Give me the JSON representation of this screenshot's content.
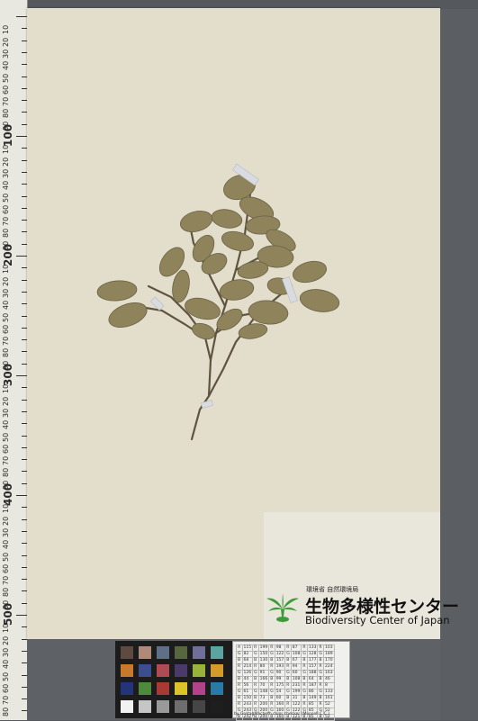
{
  "ruler": {
    "major_labels": [
      "100",
      "200",
      "300",
      "400",
      "500"
    ],
    "minor_labels": [
      "10",
      "20",
      "30",
      "40",
      "50",
      "60",
      "70",
      "80",
      "90"
    ]
  },
  "label": {
    "agency": "環境省 自然環境局",
    "center_name": "生物多様性センター",
    "center_name_en": "Biodiversity Center of Japan"
  },
  "color_card": {
    "swatches": [
      "#5e4a40",
      "#b08a78",
      "#5f6f88",
      "#56663f",
      "#6f6f9a",
      "#5aa5a0",
      "#c67a2a",
      "#3b4f8e",
      "#b04a55",
      "#4a3a6a",
      "#98b23a",
      "#d49a2a",
      "#23347a",
      "#4e8a3e",
      "#a83a33",
      "#dcc32a",
      "#b0438a",
      "#2a7aa8",
      "#f2f2f2",
      "#c6c6c6",
      "#9a9a9a",
      "#6e6e6e",
      "#464646",
      "#1e1e1e"
    ]
  },
  "value_card": {
    "rows": [
      [
        "A",
        "115",
        "R",
        "199",
        "R",
        "98",
        "R",
        "87",
        "R",
        "133",
        "R",
        "103"
      ],
      [
        "G",
        "82",
        "G",
        "150",
        "G",
        "122",
        "G",
        "108",
        "G",
        "128",
        "G",
        "189"
      ],
      [
        "B",
        "68",
        "B",
        "130",
        "B",
        "157",
        "B",
        "67",
        "B",
        "177",
        "B",
        "170"
      ],
      [
        "R",
        "214",
        "R",
        "80",
        "R",
        "193",
        "R",
        "94",
        "R",
        "157",
        "R",
        "224"
      ],
      [
        "G",
        "126",
        "G",
        "91",
        "G",
        "90",
        "G",
        "60",
        "G",
        "188",
        "G",
        "163"
      ],
      [
        "B",
        "44",
        "B",
        "166",
        "B",
        "99",
        "B",
        "108",
        "B",
        "64",
        "B",
        "46"
      ],
      [
        "R",
        "56",
        "R",
        "70",
        "R",
        "175",
        "R",
        "231",
        "R",
        "187",
        "R",
        "8"
      ],
      [
        "G",
        "61",
        "G",
        "148",
        "G",
        "54",
        "G",
        "199",
        "G",
        "86",
        "G",
        "133"
      ],
      [
        "B",
        "150",
        "B",
        "73",
        "B",
        "60",
        "B",
        "31",
        "B",
        "149",
        "B",
        "161"
      ],
      [
        "R",
        "243",
        "R",
        "200",
        "R",
        "160",
        "R",
        "122",
        "R",
        "85",
        "R",
        "52"
      ],
      [
        "G",
        "243",
        "G",
        "200",
        "G",
        "160",
        "G",
        "122",
        "G",
        "85",
        "G",
        "52"
      ],
      [
        "B",
        "242",
        "B",
        "200",
        "B",
        "160",
        "B",
        "121",
        "B",
        "85",
        "B",
        "52"
      ]
    ],
    "caption": "by GretagMacbeth color checker (Munsell C.C.)"
  }
}
